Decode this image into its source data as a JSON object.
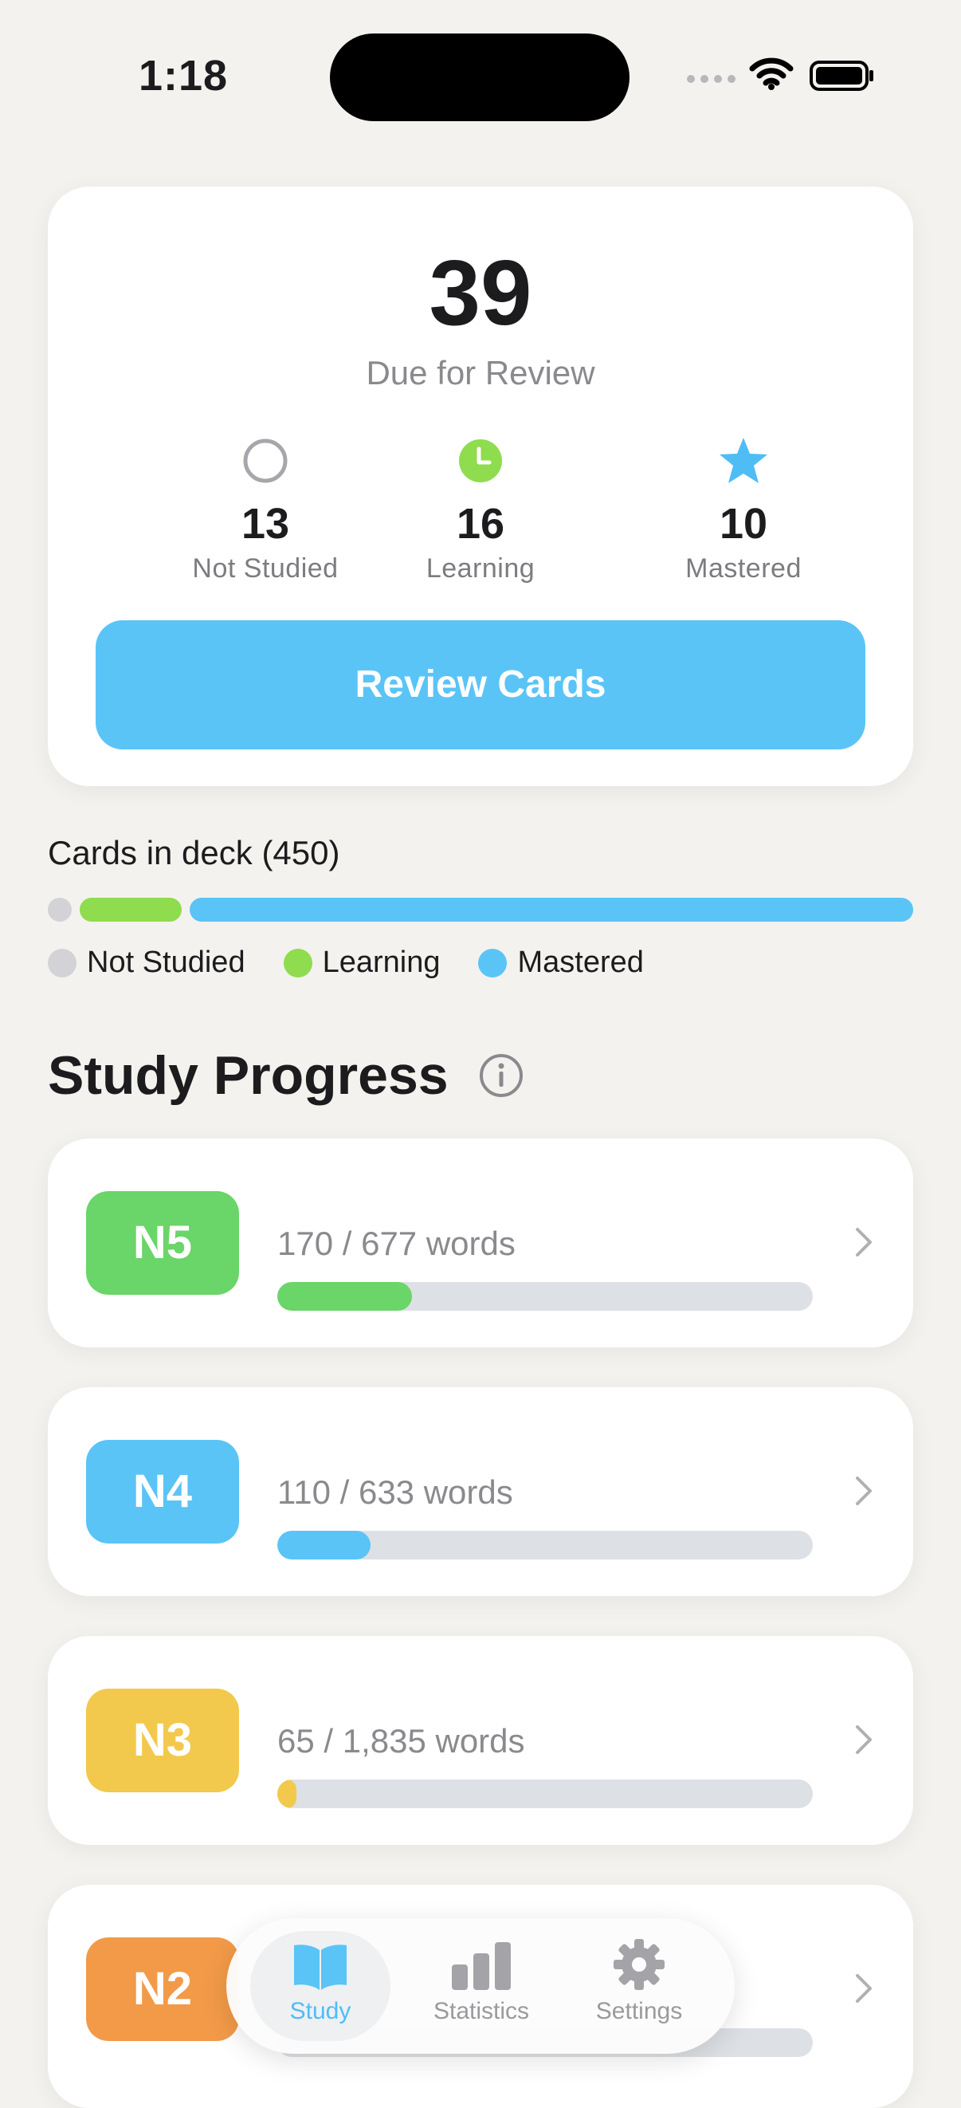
{
  "status_bar": {
    "time": "1:18"
  },
  "summary": {
    "due_count": "39",
    "due_label": "Due for Review",
    "stats": [
      {
        "icon": "empty-circle-icon",
        "count": "13",
        "label": "Not Studied",
        "color": "#a7a7ab"
      },
      {
        "icon": "clock-icon",
        "count": "16",
        "label": "Learning",
        "color": "#8fdc4e"
      },
      {
        "icon": "star-icon",
        "count": "10",
        "label": "Mastered",
        "color": "#4fbdf5"
      }
    ],
    "review_button": "Review Cards"
  },
  "deck": {
    "title": "Cards in deck (450)",
    "legend": [
      {
        "label": "Not Studied",
        "color": "#d3d3d7"
      },
      {
        "label": "Learning",
        "color": "#8fdc4e"
      },
      {
        "label": "Mastered",
        "color": "#5ac4f7"
      }
    ]
  },
  "progress": {
    "title": "Study Progress",
    "levels": [
      {
        "badge": "N5",
        "words": "170 / 677 words",
        "progress": 0.251,
        "color": "#6ad568"
      },
      {
        "badge": "N4",
        "words": "110 / 633 words",
        "progress": 0.174,
        "color": "#5ac4f7"
      },
      {
        "badge": "N3",
        "words": "65 / 1,835 words",
        "progress": 0.035,
        "color": "#f2c94c"
      },
      {
        "badge": "N2",
        "words": "",
        "progress": null,
        "color": "#f29a48"
      }
    ]
  },
  "tabbar": {
    "tabs": [
      {
        "label": "Study",
        "icon": "book-icon",
        "active": true
      },
      {
        "label": "Statistics",
        "icon": "bar-chart-icon",
        "active": false
      },
      {
        "label": "Settings",
        "icon": "gear-icon",
        "active": false
      }
    ]
  }
}
